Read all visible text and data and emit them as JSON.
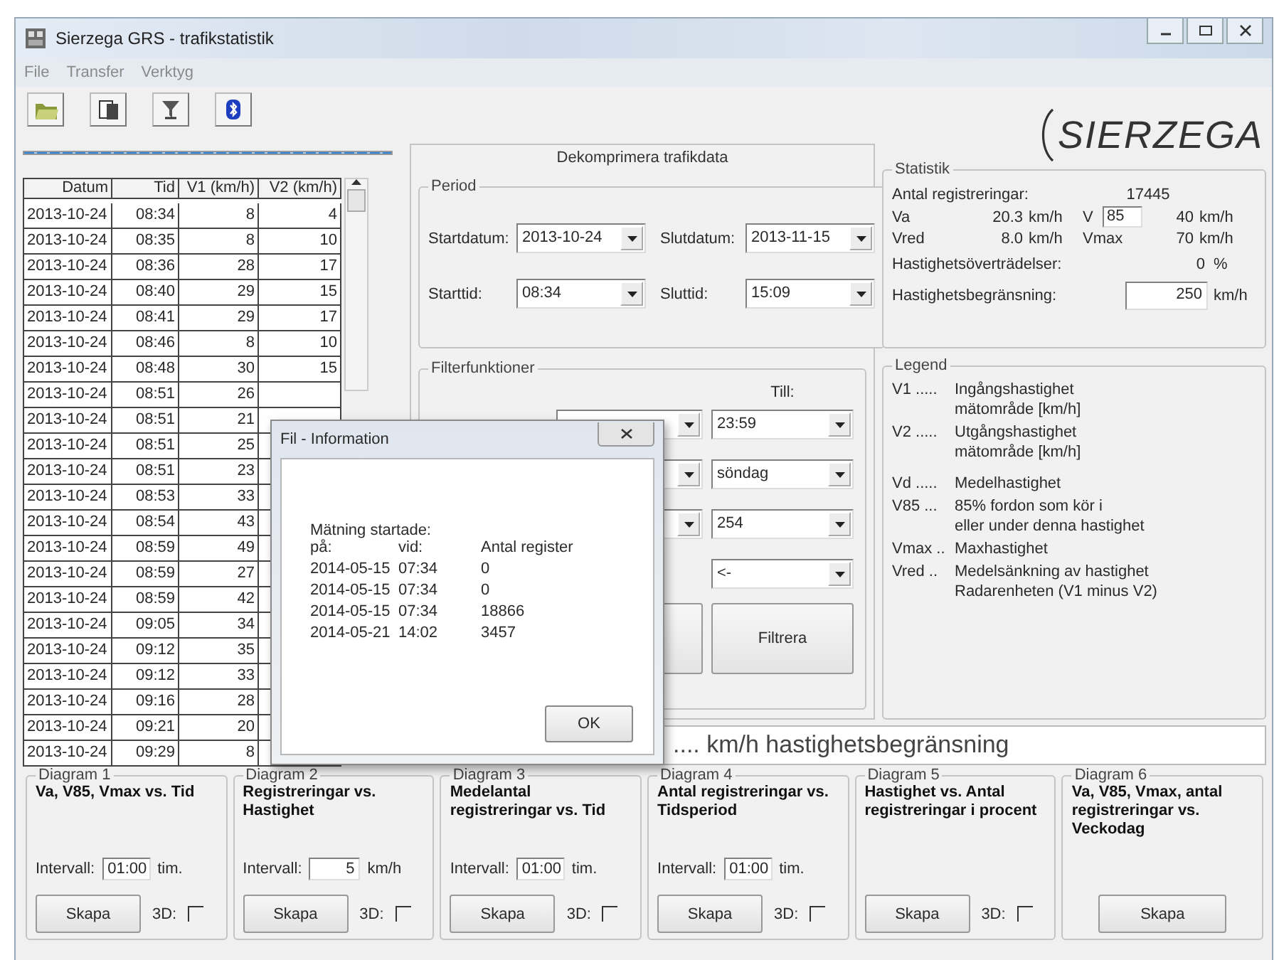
{
  "window": {
    "title": "Sierzega GRS - trafikstatistik"
  },
  "menu": [
    "File",
    "Transfer",
    "Verktyg"
  ],
  "progress": {
    "level": 1
  },
  "table": {
    "columns": [
      "Datum",
      "Tid",
      "V1 (km/h)",
      "V2 (km/h)"
    ],
    "rows": [
      {
        "datum": "2013-10-24",
        "tid": "08:34",
        "v1": "8",
        "v2": "4"
      },
      {
        "datum": "2013-10-24",
        "tid": "08:35",
        "v1": "8",
        "v2": "10"
      },
      {
        "datum": "2013-10-24",
        "tid": "08:36",
        "v1": "28",
        "v2": "17"
      },
      {
        "datum": "2013-10-24",
        "tid": "08:40",
        "v1": "29",
        "v2": "15"
      },
      {
        "datum": "2013-10-24",
        "tid": "08:41",
        "v1": "29",
        "v2": "17"
      },
      {
        "datum": "2013-10-24",
        "tid": "08:46",
        "v1": "8",
        "v2": "10"
      },
      {
        "datum": "2013-10-24",
        "tid": "08:48",
        "v1": "30",
        "v2": "15"
      },
      {
        "datum": "2013-10-24",
        "tid": "08:51",
        "v1": "26"
      },
      {
        "datum": "2013-10-24",
        "tid": "08:51",
        "v1": "21"
      },
      {
        "datum": "2013-10-24",
        "tid": "08:51",
        "v1": "25"
      },
      {
        "datum": "2013-10-24",
        "tid": "08:51",
        "v1": "23"
      },
      {
        "datum": "2013-10-24",
        "tid": "08:53",
        "v1": "33"
      },
      {
        "datum": "2013-10-24",
        "tid": "08:54",
        "v1": "43"
      },
      {
        "datum": "2013-10-24",
        "tid": "08:59",
        "v1": "49"
      },
      {
        "datum": "2013-10-24",
        "tid": "08:59",
        "v1": "27"
      },
      {
        "datum": "2013-10-24",
        "tid": "08:59",
        "v1": "42"
      },
      {
        "datum": "2013-10-24",
        "tid": "09:05",
        "v1": "34"
      },
      {
        "datum": "2013-10-24",
        "tid": "09:12",
        "v1": "35"
      },
      {
        "datum": "2013-10-24",
        "tid": "09:12",
        "v1": "33"
      },
      {
        "datum": "2013-10-24",
        "tid": "09:16",
        "v1": "28"
      },
      {
        "datum": "2013-10-24",
        "tid": "09:21",
        "v1": "20"
      },
      {
        "datum": "2013-10-24",
        "tid": "09:29",
        "v1": "8"
      }
    ]
  },
  "decompress": {
    "title": "Dekomprimera trafikdata",
    "period": {
      "label": "Period",
      "fields": [
        {
          "label": "Startdatum:",
          "value": "2013-10-24"
        },
        {
          "label": "Slutdatum:",
          "value": "2013-11-15"
        },
        {
          "label": "Starttid:",
          "value": "08:34"
        },
        {
          "label": "Sluttid:",
          "value": "15:09"
        }
      ]
    },
    "filter": {
      "label": "Filterfunktioner",
      "to_header": "Till:",
      "rows": [
        {
          "has_from": true,
          "to": "23:59"
        },
        {
          "has_from": true,
          "to": "söndag"
        },
        {
          "has_from": true,
          "to": "254"
        },
        {
          "has_from": false,
          "to": "<-"
        }
      ],
      "button": "Filtrera"
    }
  },
  "logo": "SIERZEGA",
  "statistics": {
    "label": "Statistik",
    "count_label": "Antal registreringar:",
    "count": "17445",
    "va_label": "Va",
    "va": "20.3",
    "va_unit": "km/h",
    "v85_label": "V",
    "v85_field": "85",
    "v85": "40",
    "v85_unit": "km/h",
    "vred_label": "Vred",
    "vred": "8.0",
    "vred_unit": "km/h",
    "vmax_label": "Vmax",
    "vmax": "70",
    "vmax_unit": "km/h",
    "exceed_label": "Hastighetsöverträdelser:",
    "exceed": "0",
    "exceed_unit": "%",
    "limit_label": "Hastighetsbegränsning:",
    "limit": "250",
    "limit_unit": "km/h"
  },
  "legend": {
    "label": "Legend",
    "entries": [
      {
        "key": "V1 .....",
        "lines": [
          "Ingångshastighet",
          "mätområde [km/h]"
        ]
      },
      {
        "key": "V2 .....",
        "lines": [
          "Utgångshastighet",
          "mätområde [km/h]"
        ]
      },
      {
        "key": "Vd .....",
        "lines": [
          "Medelhastighet"
        ]
      },
      {
        "key": "V85 ...",
        "lines": [
          "85% fordon som kör i",
          "eller under denna hastighet"
        ]
      },
      {
        "key": "Vmax ..",
        "lines": [
          "Maxhastighet"
        ]
      },
      {
        "key": "Vred ..",
        "lines": [
          "Medelsänkning av hastighet",
          "Radarenheten (V1 minus V2)"
        ]
      }
    ]
  },
  "speed_limit_banner": ".... km/h hastighetsbegränsning",
  "diagrams": [
    {
      "label": "Diagram 1",
      "title": "Va, V85, Vmax vs. Tid",
      "interval_label": "Intervall:",
      "interval": "01:00",
      "interval_unit": "tim.",
      "button": "Skapa",
      "three_d": {
        "label": "3D:",
        "checked": false
      }
    },
    {
      "label": "Diagram 2",
      "title": "Registreringar vs. Hastighet",
      "interval_label": "Intervall:",
      "interval": "5",
      "interval_unit": "km/h",
      "button": "Skapa",
      "three_d": {
        "label": "3D:",
        "checked": false
      }
    },
    {
      "label": "Diagram 3",
      "title": "Medelantal registreringar vs. Tid",
      "interval_label": "Intervall:",
      "interval": "01:00",
      "interval_unit": "tim.",
      "button": "Skapa",
      "three_d": {
        "label": "3D:",
        "checked": false
      }
    },
    {
      "label": "Diagram 4",
      "title": "Antal registreringar vs. Tidsperiod",
      "interval_label": "Intervall:",
      "interval": "01:00",
      "interval_unit": "tim.",
      "button": "Skapa",
      "three_d": {
        "label": "3D:",
        "checked": false
      }
    },
    {
      "label": "Diagram 5",
      "title": "Hastighet vs. Antal registreringar i procent",
      "button": "Skapa",
      "three_d": {
        "label": "3D:",
        "checked": false
      }
    },
    {
      "label": "Diagram 6",
      "title": "Va, V85, Vmax, antal registreringar vs. Veckodag",
      "button": "Skapa"
    }
  ],
  "dialog": {
    "title": "Fil - Information",
    "heading": "Mätning startade:",
    "columns": [
      "på:",
      "vid:",
      "Antal register"
    ],
    "rows": [
      [
        "2014-05-15",
        "07:34",
        "0"
      ],
      [
        "2014-05-15",
        "07:34",
        "0"
      ],
      [
        "2014-05-15",
        "07:34",
        "18866"
      ],
      [
        "2014-05-21",
        "14:02",
        "3457"
      ]
    ],
    "button": "OK"
  }
}
